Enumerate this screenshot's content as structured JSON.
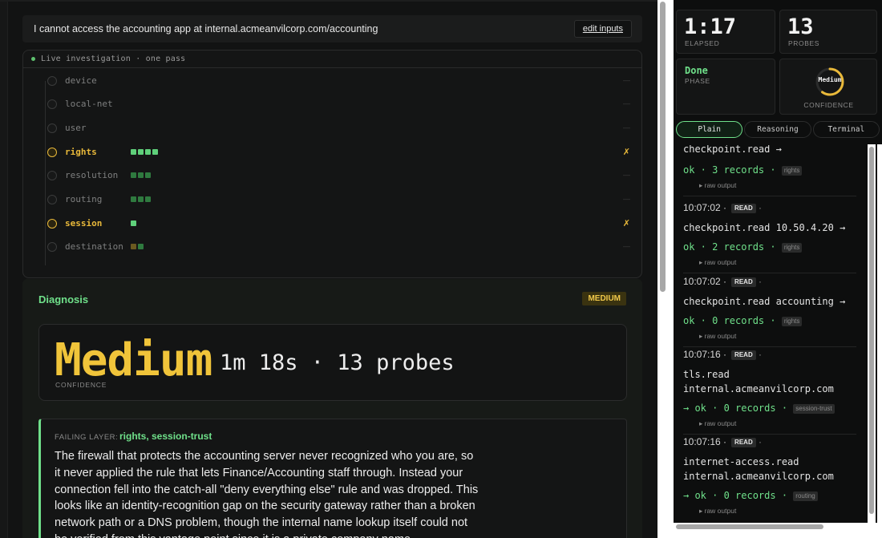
{
  "query": {
    "text": "I cannot access the accounting app at internal.acmeanvilcorp.com/accounting",
    "edit_label": "edit inputs"
  },
  "investigation": {
    "title": "Live investigation · one pass",
    "layers": [
      {
        "name": "device",
        "status": "idle",
        "blocks": 0,
        "mark": "—"
      },
      {
        "name": "local-net",
        "status": "idle",
        "blocks": 0,
        "mark": "—"
      },
      {
        "name": "user",
        "status": "idle",
        "blocks": 0,
        "mark": "—"
      },
      {
        "name": "rights",
        "status": "warn",
        "blocks": 4,
        "mark": "✗"
      },
      {
        "name": "resolution",
        "status": "ok",
        "blocks": 3,
        "mark": "—"
      },
      {
        "name": "routing",
        "status": "ok",
        "blocks": 3,
        "mark": "—"
      },
      {
        "name": "session",
        "status": "warn",
        "blocks": 1,
        "mark": "✗"
      },
      {
        "name": "destination",
        "status": "mixed",
        "blocks": 2,
        "mark": "—"
      }
    ]
  },
  "diagnosis": {
    "title": "Diagnosis",
    "badge": "MEDIUM",
    "confidence_value": "Medium",
    "meta": "1m 18s · 13 probes",
    "confidence_label": "CONFIDENCE",
    "failing_label": "FAILING LAYER:",
    "failing_value": "rights, session-trust",
    "text": "The firewall that protects the accounting server never recognized who you are, so it never applied the rule that lets Finance/Accounting staff through. Instead your connection fell into the catch-all \"deny everything else\" rule and was dropped. This looks like an identity-recognition gap on the security gateway rather than a broken network path or a DNS problem, though the internal name lookup itself could not be verified from this vantage point since it is a private company name."
  },
  "stats": {
    "elapsed": {
      "value": "1:17",
      "label": "ELAPSED"
    },
    "probes": {
      "value": "13",
      "label": "PROBES"
    },
    "phase": {
      "value": "Done",
      "label": "PHASE"
    },
    "confidence": {
      "value": "Medium",
      "label": "CONFIDENCE",
      "fraction": 0.6
    }
  },
  "tabs": [
    "Plain",
    "Reasoning",
    "Terminal"
  ],
  "log": [
    {
      "time": "",
      "badge": "",
      "cmd": "checkpoint.read →",
      "result": "ok · 3 records ·",
      "tag": "rights",
      "raw": "▸ raw output"
    },
    {
      "time": "10:07:02 ·",
      "badge": "READ",
      "cmd": "checkpoint.read 10.50.4.20 →",
      "result": "ok · 2 records ·",
      "tag": "rights",
      "raw": "▸ raw output"
    },
    {
      "time": "10:07:02 ·",
      "badge": "READ",
      "cmd": "checkpoint.read accounting →",
      "result": "ok · 0 records ·",
      "tag": "rights",
      "raw": "▸ raw output"
    },
    {
      "time": "10:07:16 ·",
      "badge": "READ",
      "cmd": "tls.read\ninternal.acmeanvilcorp.com",
      "result": "→ ok · 0 records ·",
      "tag": "session-trust",
      "raw": "▸ raw output"
    },
    {
      "time": "10:07:16 ·",
      "badge": "READ",
      "cmd": "internet-access.read\ninternal.acmeanvilcorp.com",
      "result": "→ ok · 0 records ·",
      "tag": "routing",
      "raw": "▸ raw output"
    }
  ],
  "colors": {
    "accent_green": "#6fe08a",
    "warn_amber": "#e9b93a",
    "confidence_yellow": "#f0c43a",
    "block_bright": "#5fd07a",
    "block_dim": "#2f7a3f",
    "block_brown": "#6b5a20"
  }
}
